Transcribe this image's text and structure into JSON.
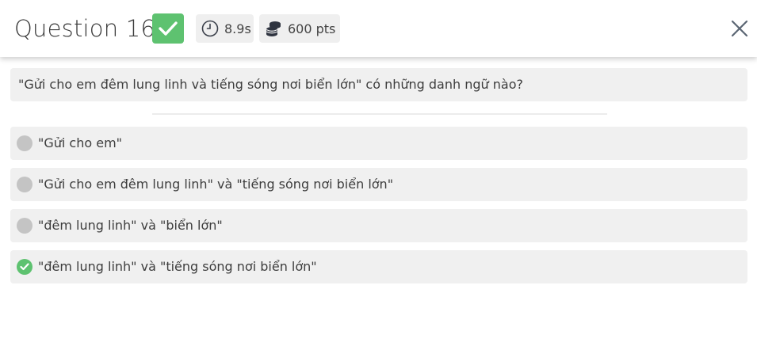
{
  "header": {
    "title": "Question 16",
    "time": "8.9s",
    "points": "600 pts",
    "icons": {
      "status": "check-icon",
      "time": "clock-icon",
      "points": "coins-icon",
      "close": "close-icon"
    }
  },
  "question": {
    "text": "\"Gửi cho em đêm lung linh và tiếng sóng nơi biển lớn\" có những danh ngữ nào?"
  },
  "options": [
    {
      "label": "\"Gửi cho em\"",
      "state": "unselected"
    },
    {
      "label": "\"Gửi cho em đêm lung linh\" và \"tiếng sóng nơi biển lớn\"",
      "state": "unselected"
    },
    {
      "label": "\"đêm lung linh\" và \"biển lớn\"",
      "state": "unselected"
    },
    {
      "label": "\"đêm lung linh\" và \"tiếng sóng nơi biển lớn\"",
      "state": "correct"
    }
  ],
  "colors": {
    "correct": "#5ec270",
    "neutral_marker": "#c4c4c4",
    "panel": "#f0f0f0"
  }
}
